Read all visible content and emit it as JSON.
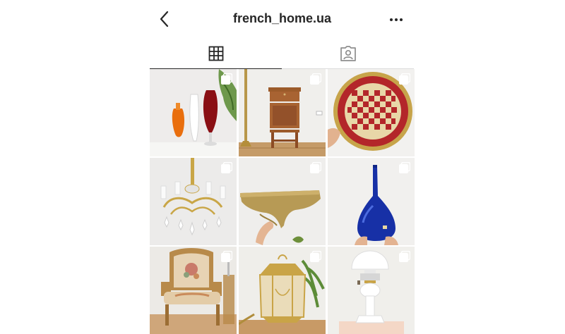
{
  "header": {
    "username": "french_home.ua",
    "back_icon": "chevron-left-icon",
    "more_icon": "more-horizontal-icon"
  },
  "tabs": [
    {
      "icon": "grid-icon",
      "active": true
    },
    {
      "icon": "tagged-person-icon",
      "active": false
    }
  ],
  "posts": [
    {
      "subject": "vases",
      "multi": true
    },
    {
      "subject": "nightstand",
      "multi": true
    },
    {
      "subject": "tray",
      "multi": true
    },
    {
      "subject": "chandelier",
      "multi": true
    },
    {
      "subject": "wall-shelf",
      "multi": true
    },
    {
      "subject": "blue-vase",
      "multi": true
    },
    {
      "subject": "armchair",
      "multi": true
    },
    {
      "subject": "lantern",
      "multi": true
    },
    {
      "subject": "oil-lamp",
      "multi": true
    }
  ]
}
